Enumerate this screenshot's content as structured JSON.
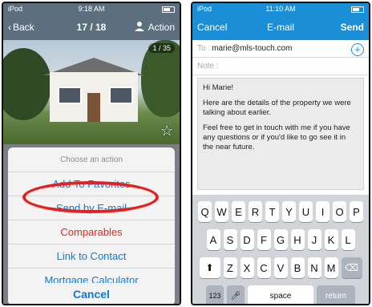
{
  "left_screen": {
    "status": {
      "carrier": "iPod",
      "time": "9:18 AM"
    },
    "nav": {
      "back_label": "Back",
      "title": "17 / 18",
      "action_label": "Action"
    },
    "photo": {
      "counter": "1 / 35"
    },
    "action_sheet": {
      "title": "Choose an action",
      "options": [
        "Add To Favorites",
        "Send by E-mail",
        "Comparables",
        "Link to Contact",
        "Mortgage Calculator"
      ],
      "cancel_label": "Cancel"
    },
    "colors": {
      "nav_bg": "#5d6f7f",
      "option_blue": "#0a7bd9",
      "option_red": "#e0291c",
      "highlight": "#e61f1f"
    }
  },
  "right_screen": {
    "status": {
      "carrier": "iPod",
      "time": "11:10 AM"
    },
    "nav": {
      "cancel_label": "Cancel",
      "title": "E-mail",
      "send_label": "Send"
    },
    "to_label": "To :",
    "to_value": "marie@mls-touch.com",
    "note_label": "Note :",
    "message": [
      "Hi Marie!",
      "Here are the details of the property we were talking about earlier.",
      "Feel free to get in touch with me if you have any questions or if you'd like to go see it in the near future."
    ],
    "keyboard": {
      "row1": [
        "Q",
        "W",
        "E",
        "R",
        "T",
        "Y",
        "U",
        "I",
        "O",
        "P"
      ],
      "row2": [
        "A",
        "S",
        "D",
        "F",
        "G",
        "H",
        "J",
        "K",
        "L"
      ],
      "row3": [
        "Z",
        "X",
        "C",
        "V",
        "B",
        "N",
        "M"
      ],
      "num_label": "123",
      "space_label": "space",
      "return_label": "return"
    },
    "colors": {
      "nav_bg": "#1a8fd8",
      "keyboard_bg": "#d1d4d9"
    }
  }
}
